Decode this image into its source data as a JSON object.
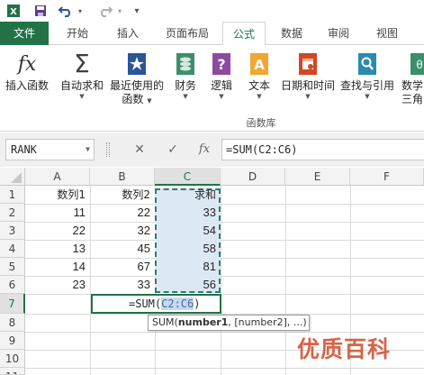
{
  "quick_access": {
    "icons": [
      "excel-app-icon",
      "save-icon",
      "undo-icon",
      "redo-icon",
      "customize-icon"
    ]
  },
  "tabs": [
    {
      "label": "文件",
      "active": false
    },
    {
      "label": "开始",
      "active": false
    },
    {
      "label": "插入",
      "active": false
    },
    {
      "label": "页面布局",
      "active": false
    },
    {
      "label": "公式",
      "active": true
    },
    {
      "label": "数据",
      "active": false
    },
    {
      "label": "审阅",
      "active": false
    },
    {
      "label": "视图",
      "active": false
    }
  ],
  "ribbon": {
    "insert_function": "插入函数",
    "autosum": "自动求和",
    "recent_line1": "最近使用的",
    "recent_line2": "函数",
    "financial": "财务",
    "logical": "逻辑",
    "text": "文本",
    "datetime": "日期和时间",
    "lookup": "查找与引用",
    "math_line1": "数学",
    "math_line2": "三角",
    "group_label": "函数库"
  },
  "formula_bar": {
    "name_box": "RANK",
    "cancel": "✕",
    "enter": "✓",
    "fx": "fx",
    "formula": "=SUM(C2:C6)"
  },
  "grid": {
    "columns": [
      "A",
      "B",
      "C",
      "D",
      "E",
      "F"
    ],
    "rows": [
      "1",
      "2",
      "3",
      "4",
      "5",
      "6",
      "7",
      "8",
      "9",
      "10",
      "11"
    ],
    "headers": {
      "a1": "数列1",
      "b1": "数列2",
      "c1": "求和"
    },
    "col_a": [
      "11",
      "22",
      "13",
      "14",
      "23"
    ],
    "col_b": [
      "22",
      "32",
      "45",
      "67",
      "33"
    ],
    "col_c": [
      "33",
      "54",
      "58",
      "81",
      "56"
    ],
    "edit_prefix": "=SUM(",
    "edit_ref": "C2:C6",
    "edit_suffix": ")",
    "tooltip_fn": "SUM(",
    "tooltip_arg1": "number1",
    "tooltip_rest": ", [number2], ...)"
  },
  "watermark": "优质百科",
  "colors": {
    "accent": "#217346",
    "range_fill": "#dde8f5",
    "watermark": "#d0492a"
  }
}
